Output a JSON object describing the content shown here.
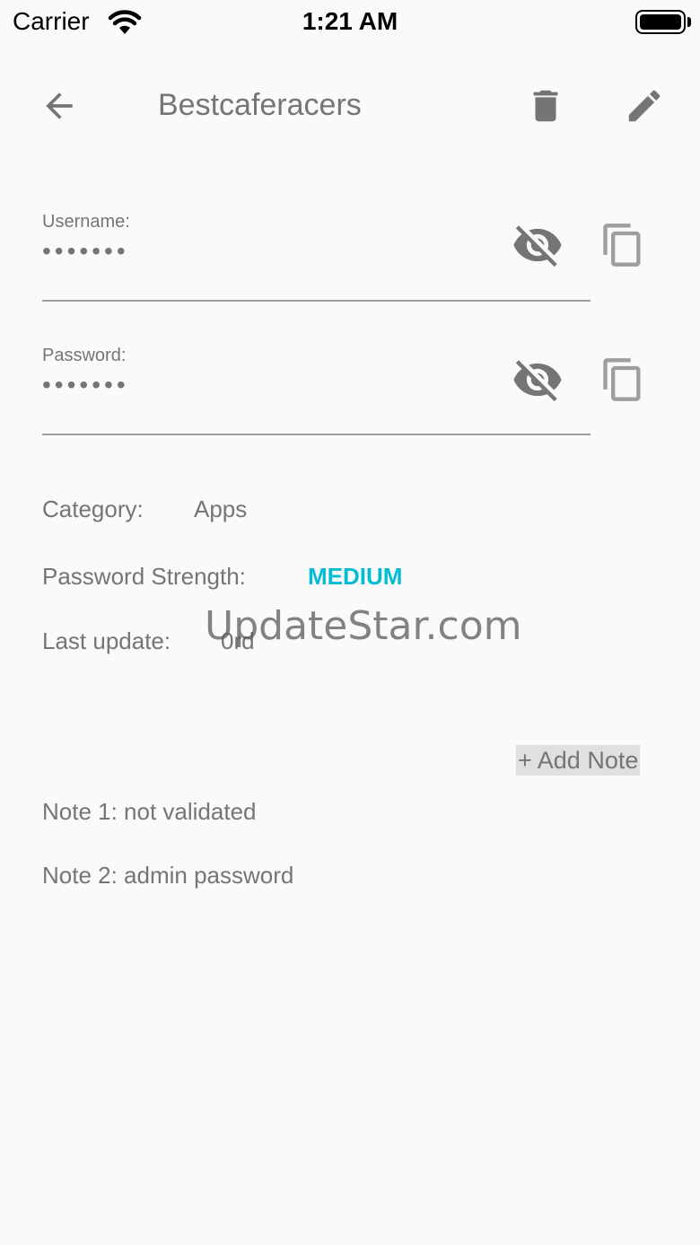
{
  "status_bar": {
    "carrier": "Carrier",
    "time": "1:21 AM"
  },
  "app_bar": {
    "title": "Bestcaferacers",
    "icons": {
      "back": "arrow-back-icon",
      "delete": "trash-icon",
      "edit": "pencil-icon"
    }
  },
  "fields": [
    {
      "label": "Username:",
      "value": "•••••••"
    },
    {
      "label": "Password:",
      "value": "•••••••"
    }
  ],
  "info": {
    "category_label": "Category:",
    "category_value": "Apps",
    "strength_label": "Password Strength:",
    "strength_value": "MEDIUM",
    "last_update_label": "Last update:",
    "last_update_value": "0rd"
  },
  "watermark": "UpdateStar.com",
  "add_note_label": "+ Add Note",
  "notes": [
    "Note 1: not validated",
    "Note 2: admin password"
  ],
  "colors": {
    "background": "#fafafa",
    "text": "#757575",
    "accent": "#00bcd4",
    "divider": "#9e9e9e"
  }
}
